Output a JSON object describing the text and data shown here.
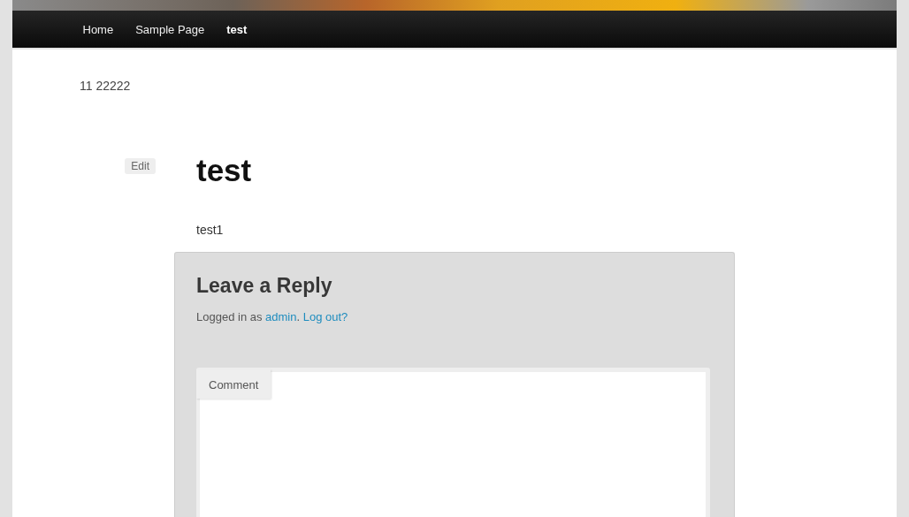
{
  "nav": {
    "items": [
      {
        "label": "Home",
        "selected": false
      },
      {
        "label": "Sample Page",
        "selected": false
      },
      {
        "label": "test",
        "selected": true
      }
    ]
  },
  "site_description": "11 22222",
  "post": {
    "edit_label": "Edit",
    "title": "test",
    "content": "test1"
  },
  "reply": {
    "title": "Leave a Reply",
    "logged_in": {
      "prefix": "Logged in as ",
      "user_link": "admin",
      "separator": ". ",
      "logout_link": "Log out?"
    },
    "comment_label": "Comment"
  }
}
